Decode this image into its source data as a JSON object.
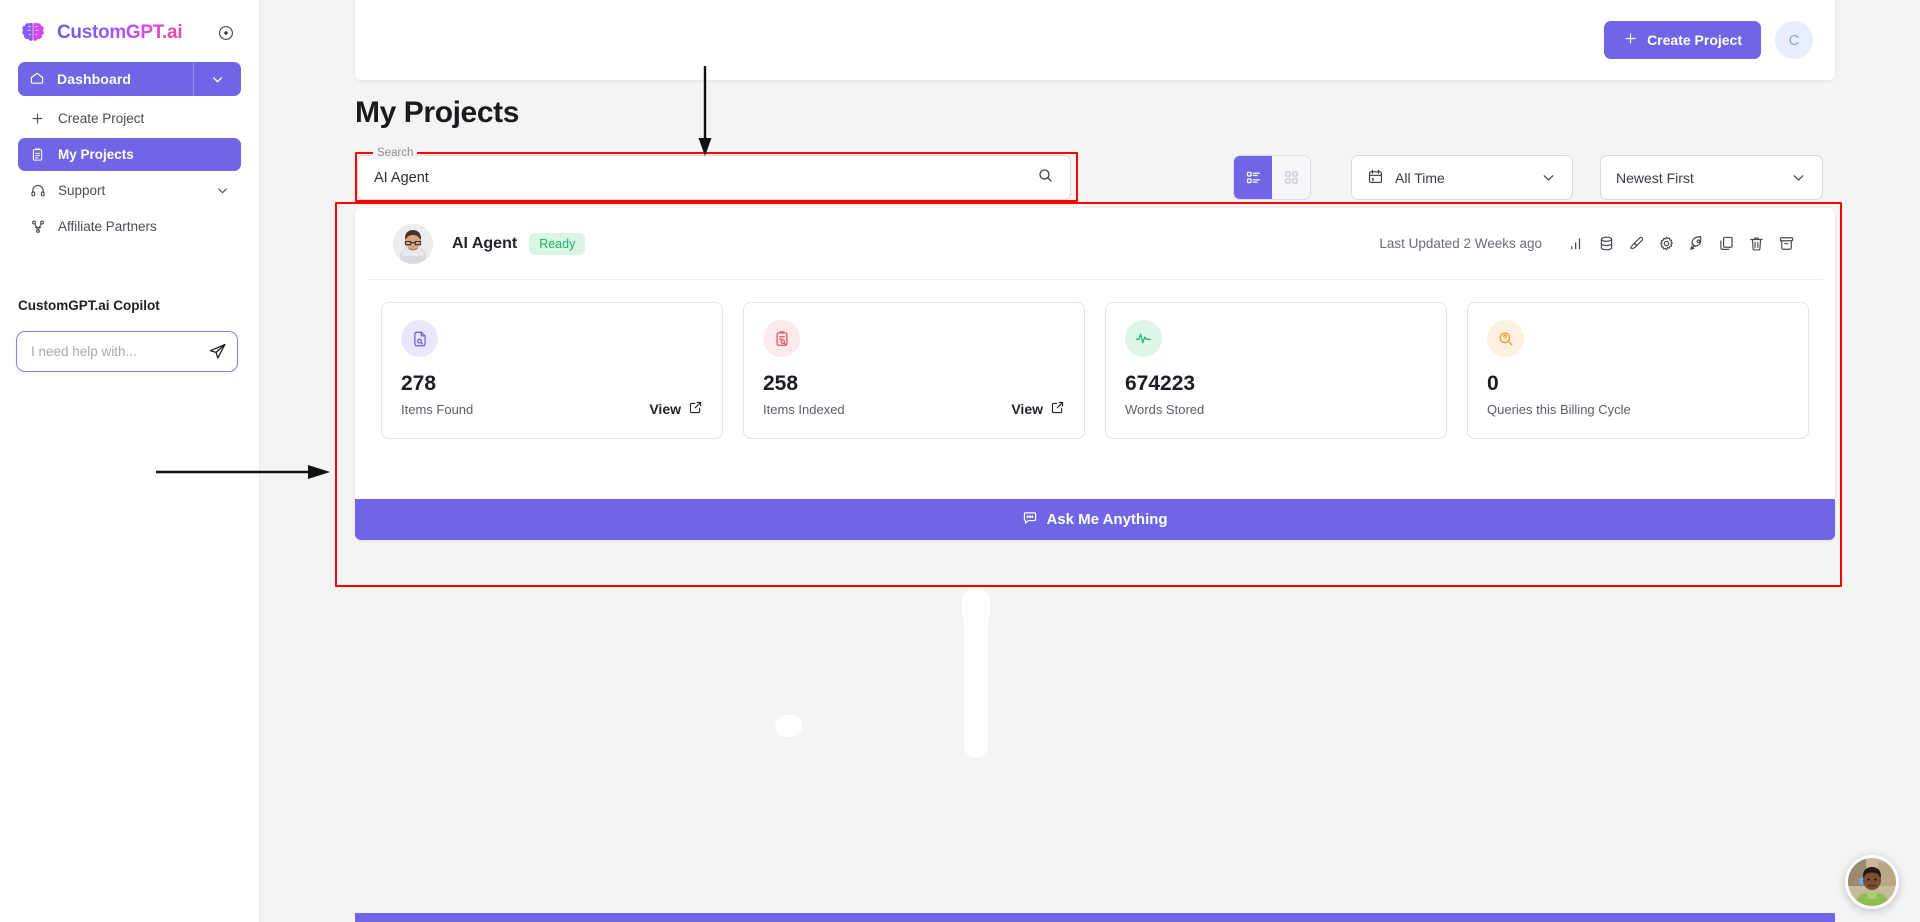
{
  "sidebar": {
    "brand": {
      "name": "CustomGPT.ai",
      "info_icon": "info-circle-icon"
    },
    "primary_nav": {
      "label": "Dashboard",
      "icon": "home-icon",
      "caret": "chevron-down-icon"
    },
    "items": [
      {
        "label": "Create Project",
        "icon": "plus-icon",
        "active": false,
        "caret": null
      },
      {
        "label": "My Projects",
        "icon": "clipboard-icon",
        "active": true,
        "caret": null
      },
      {
        "label": "Support",
        "icon": "headset-icon",
        "active": false,
        "caret": "chevron-down-icon"
      },
      {
        "label": "Affiliate Partners",
        "icon": "share-nodes-icon",
        "active": false,
        "caret": null
      }
    ],
    "copilot": {
      "title": "CustomGPT.ai Copilot",
      "input_value": "",
      "input_placeholder": "I need help with...",
      "send_icon": "send-paper-plane-icon"
    }
  },
  "topbar": {
    "create_project_label": "Create Project",
    "create_project_icon": "plus-icon",
    "user_avatar_initial": "C"
  },
  "main": {
    "page_title": "My Projects",
    "search": {
      "float_label": "Search",
      "value": "AI Agent",
      "placeholder": "Search",
      "icon": "search-icon"
    },
    "view_toggle": {
      "list_icon": "list-view-icon",
      "grid_icon": "grid-view-icon",
      "active": "list"
    },
    "filters": [
      {
        "name": "time-range",
        "icon": "calendar-icon",
        "value": "All Time",
        "caret": "chevron-down-icon"
      },
      {
        "name": "sort-order",
        "icon": null,
        "value": "Newest First",
        "caret": "chevron-down-icon"
      }
    ]
  },
  "project": {
    "avatar_icon": "user-photo-avatar",
    "name": "AI Agent",
    "status": "Ready",
    "last_updated": "Last Updated 2 Weeks ago",
    "actions": [
      {
        "name": "analytics-bar-chart-icon",
        "title": "Analytics"
      },
      {
        "name": "database-icon",
        "title": "Data"
      },
      {
        "name": "paintbrush-icon",
        "title": "Design"
      },
      {
        "name": "gear-icon",
        "title": "Settings"
      },
      {
        "name": "rocket-icon",
        "title": "Deploy"
      },
      {
        "name": "copy-icon",
        "title": "Duplicate"
      },
      {
        "name": "trash-icon",
        "title": "Delete"
      },
      {
        "name": "archive-icon",
        "title": "Archive"
      }
    ],
    "stats": [
      {
        "value": "278",
        "label": "Items Found",
        "icon": "file-search-icon",
        "icon_color": "#6c5ce7",
        "icon_bg": "#eae7fd",
        "action": "View",
        "action_icon": "external-link-icon"
      },
      {
        "value": "258",
        "label": "Items Indexed",
        "icon": "clipboard-search-icon",
        "icon_color": "#e8505b",
        "icon_bg": "#fdeaec",
        "action": "View",
        "action_icon": "external-link-icon"
      },
      {
        "value": "674223",
        "label": "Words Stored",
        "icon": "activity-pulse-icon",
        "icon_color": "#22c171",
        "icon_bg": "#ddf6e8",
        "action": null,
        "action_icon": null
      },
      {
        "value": "0",
        "label": "Queries this Billing Cycle",
        "icon": "query-search-icon",
        "icon_color": "#f5921e",
        "icon_bg": "#fdf0de",
        "action": null,
        "action_icon": null
      }
    ],
    "ask_bar": {
      "label": "Ask Me Anything",
      "icon": "chat-bubble-icon"
    }
  },
  "chat_widget": {
    "name": "support-chat-avatar"
  },
  "annotations": {
    "highlight_color": "#ff0000",
    "boxes": [
      "search-field",
      "project-card"
    ],
    "arrows": [
      "arrow-down-to-search",
      "arrow-right-to-card"
    ]
  },
  "colors": {
    "accent_purple": "#7065e4",
    "ready_green": "#21b35f",
    "page_bg": "#f4f4f5",
    "annotation_red": "#ff0000"
  }
}
